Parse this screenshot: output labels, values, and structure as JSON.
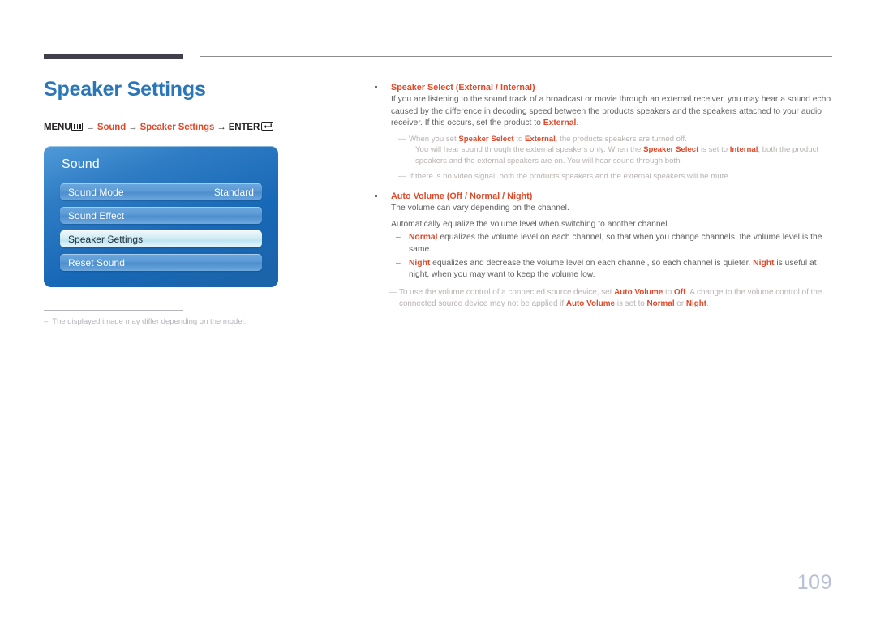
{
  "document": {
    "page_number": "109",
    "title": "Speaker Settings",
    "accent_color": "#e0492a",
    "title_color": "#2b76b9"
  },
  "breadcrumb": {
    "menu_label": "MENU",
    "menu_icon": "menu-bars-icon",
    "arrow": "→",
    "step1": "Sound",
    "step2": "Speaker Settings",
    "enter_label": "ENTER",
    "enter_icon": "enter-return-icon"
  },
  "osd": {
    "title": "Sound",
    "rows": [
      {
        "label": "Sound Mode",
        "value": "Standard",
        "selected": false
      },
      {
        "label": "Sound Effect",
        "value": "",
        "selected": false
      },
      {
        "label": "Speaker Settings",
        "value": "",
        "selected": true
      },
      {
        "label": "Reset Sound",
        "value": "",
        "selected": false
      }
    ]
  },
  "footnote": {
    "dash": "–",
    "text": "The displayed image may differ depending on the model."
  },
  "content": {
    "speaker_select": {
      "heading_bold": "Speaker Select",
      "heading_options": "(External / Internal)",
      "body": "If you are listening to the sound track of a broadcast or movie through an external receiver, you may hear a sound echo caused by the difference in decoding speed between the products speakers and the speakers attached to your audio receiver. If this occurs, set the product to ",
      "body_bold_tail": "External",
      "body_tail": ".",
      "note1_a": "When you set ",
      "note1_b": "Speaker Select",
      "note1_c": " to ",
      "note1_d": "External",
      "note1_e": ", the products speakers are turned off.",
      "note1_line2_a": "You will hear sound through the external speakers only. When the ",
      "note1_line2_b": "Speaker Select",
      "note1_line2_c": " is set to ",
      "note1_line2_d": "Internal",
      "note1_line2_e": ", both the product speakers and the external speakers are on. You will hear sound through both.",
      "note2": "If there is no video signal, both the products speakers and the external speakers will be mute."
    },
    "auto_volume": {
      "heading_bold": "Auto Volume",
      "heading_options": "(Off / Normal / Night)",
      "body1": "The volume can vary depending on the channel.",
      "body2": "Automatically equalize the volume level when switching to another channel.",
      "items": [
        {
          "dash": "–",
          "bold": "Normal",
          "text": " equalizes the volume level on each channel, so that when you change channels, the volume level is the same."
        },
        {
          "dash": "–",
          "bold": "Night",
          "text_a": " equalizes and decrease the volume level on each channel, so each channel is quieter. ",
          "bold2": "Night",
          "text_b": " is useful at night, when you may want to keep the volume low."
        }
      ],
      "final_note_a": "To use the volume control of a connected source device, set ",
      "final_note_b": "Auto Volume",
      "final_note_c": " to ",
      "final_note_d": "Off",
      "final_note_e": ". A change to the volume control of the connected source device may not be applied if ",
      "final_note_f": "Auto Volume",
      "final_note_g": " is set to ",
      "final_note_h": "Normal",
      "final_note_i": " or ",
      "final_note_j": "Night",
      "final_note_k": "."
    }
  }
}
